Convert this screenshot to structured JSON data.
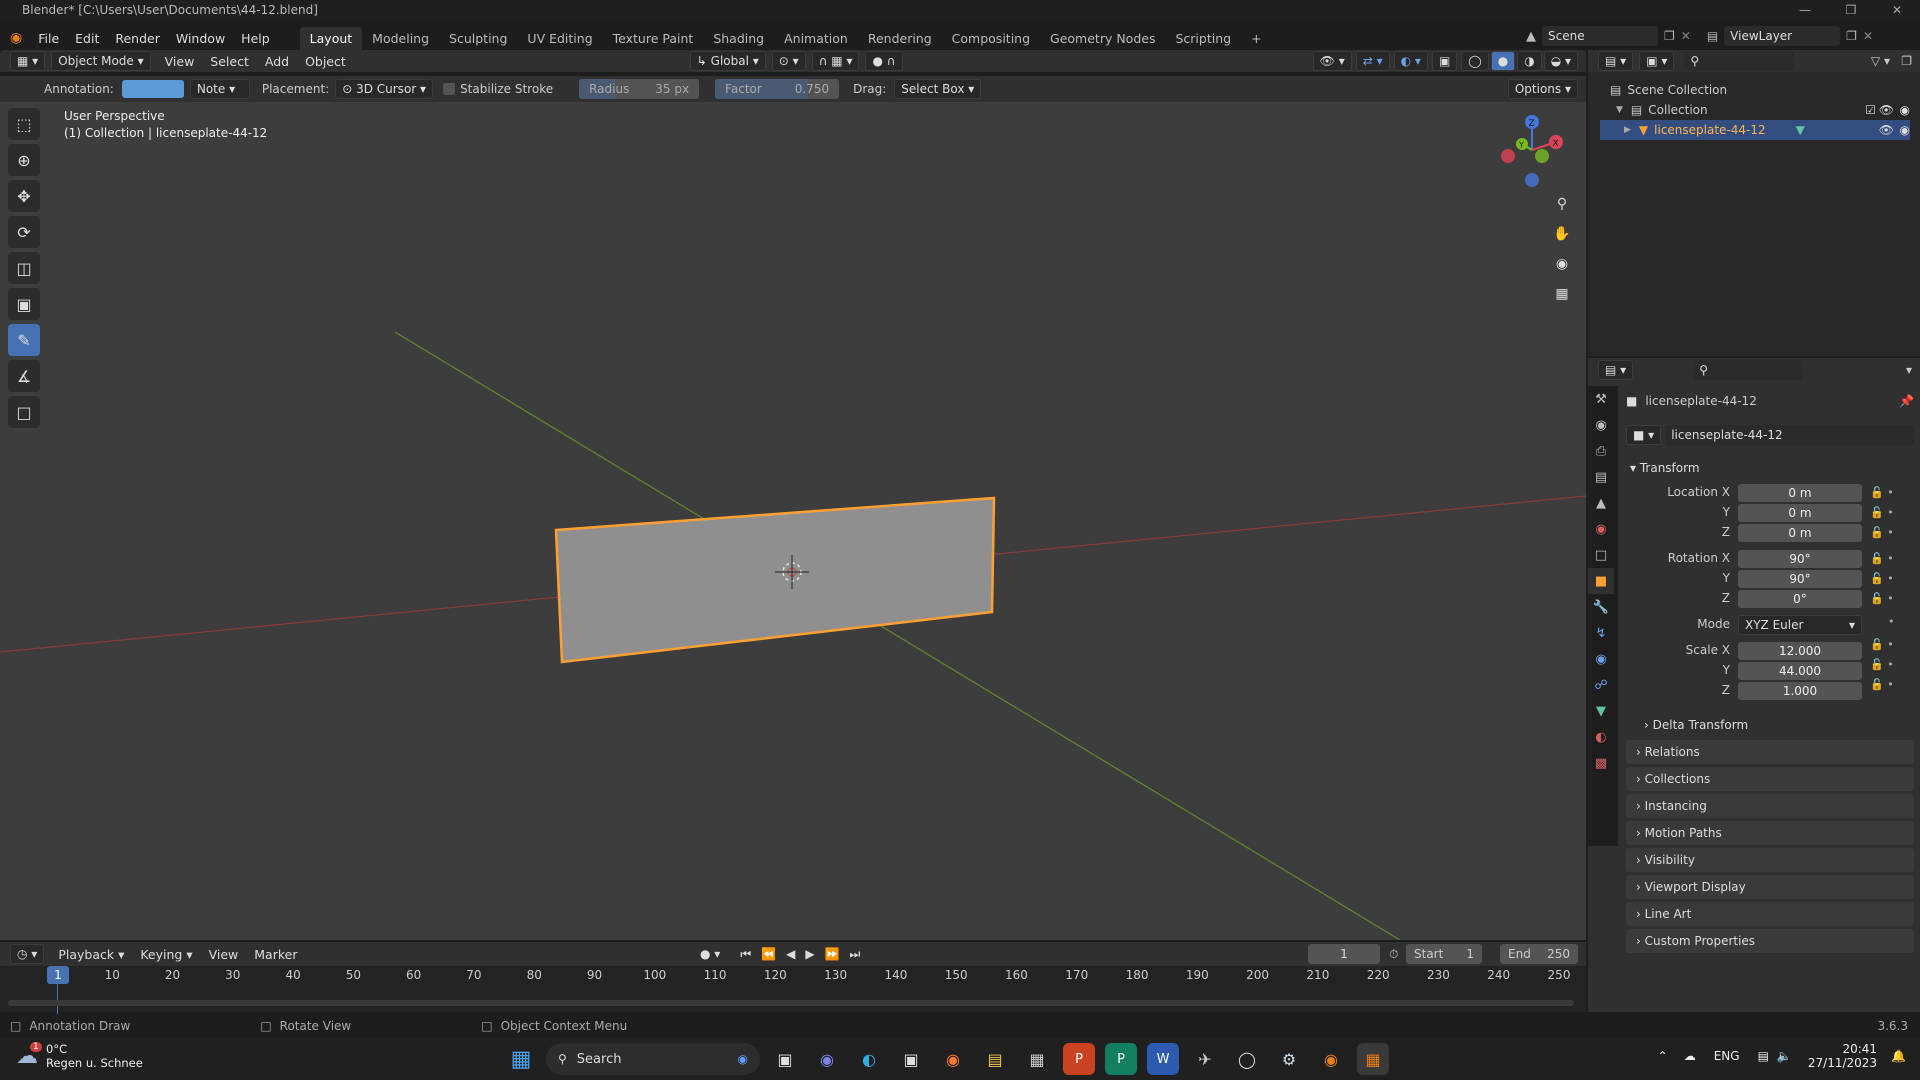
{
  "title": "Blender* [C:\\Users\\User\\Documents\\44-12.blend]",
  "menu": [
    "File",
    "Edit",
    "Render",
    "Window",
    "Help"
  ],
  "workspaces": [
    "Layout",
    "Modeling",
    "Sculpting",
    "UV Editing",
    "Texture Paint",
    "Shading",
    "Animation",
    "Rendering",
    "Compositing",
    "Geometry Nodes",
    "Scripting"
  ],
  "scene": "Scene",
  "view_layer": "ViewLayer",
  "vp_header": {
    "mode": "Object Mode",
    "view": "View",
    "select": "Select",
    "add": "Add",
    "object": "Object",
    "transform": "Global",
    "options": "Options"
  },
  "tool_header": {
    "annotation_label": "Annotation:",
    "note": "Note",
    "placement_label": "Placement:",
    "placement": "3D Cursor",
    "stabilize": "Stabilize Stroke",
    "radius_label": "Radius",
    "radius_value": "35 px",
    "factor_label": "Factor",
    "factor_value": "0.750",
    "drag_label": "Drag:",
    "drag": "Select Box"
  },
  "viewport": {
    "line1": "User Perspective",
    "line2": "(1) Collection | licenseplate-44-12"
  },
  "outliner": {
    "scene_collection": "Scene Collection",
    "collection": "Collection",
    "object": "licenseplate-44-12"
  },
  "props": {
    "object_name": "licenseplate-44-12",
    "data_name": "licenseplate-44-12",
    "transform": "Transform",
    "location_x_label": "Location X",
    "loc_x": "0 m",
    "y_label": "Y",
    "loc_y": "0 m",
    "z_label": "Z",
    "loc_z": "0 m",
    "rotation_x_label": "Rotation X",
    "rot_x": "90°",
    "rot_y": "90°",
    "rot_z": "0°",
    "mode_label": "Mode",
    "mode": "XYZ Euler",
    "scale_x_label": "Scale X",
    "scale_x": "12.000",
    "scale_y": "44.000",
    "scale_z": "1.000",
    "delta": "Delta Transform",
    "panels": [
      "Relations",
      "Collections",
      "Instancing",
      "Motion Paths",
      "Visibility",
      "Viewport Display",
      "Line Art",
      "Custom Properties"
    ]
  },
  "timeline": {
    "playback": "Playback",
    "keying": "Keying",
    "view": "View",
    "marker": "Marker",
    "current": "1",
    "start_label": "Start",
    "start": "1",
    "end_label": "End",
    "end": "250",
    "ticks": [
      "1",
      "10",
      "20",
      "30",
      "40",
      "50",
      "60",
      "70",
      "80",
      "90",
      "100",
      "110",
      "120",
      "130",
      "140",
      "150",
      "160",
      "170",
      "180",
      "190",
      "200",
      "210",
      "220",
      "230",
      "240",
      "250"
    ]
  },
  "status": {
    "a": "Annotation Draw",
    "b": "Rotate View",
    "c": "Object Context Menu",
    "version": "3.6.3"
  },
  "taskbar": {
    "temp": "0°C",
    "weather": "Regen u. Schnee",
    "search": "Search",
    "lang": "ENG",
    "time": "20:41",
    "date": "27/11/2023",
    "badge": "1"
  },
  "colors": {
    "accent": "#4772b3",
    "selected_orange": "#ffa033",
    "bg_viewport": "#3d3d3d"
  }
}
